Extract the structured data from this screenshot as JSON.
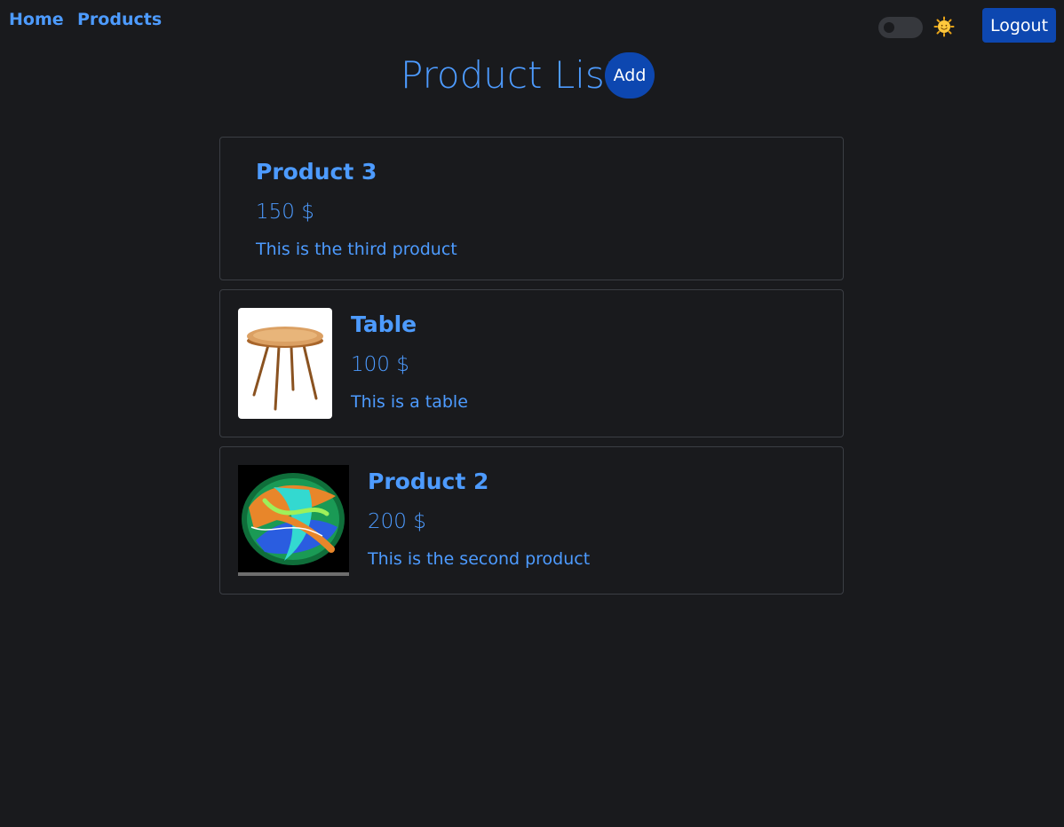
{
  "nav": {
    "home_label": "Home",
    "products_label": "Products",
    "logout_label": "Logout",
    "theme_icon": "sun-icon"
  },
  "header": {
    "title": "Product List",
    "add_label": "Add"
  },
  "products": [
    {
      "name": "Product 3",
      "price": "150 $",
      "description": "This is the third product",
      "image": null
    },
    {
      "name": "Table",
      "price": "100 $",
      "description": "This is a table",
      "image": "table-image"
    },
    {
      "name": "Product 2",
      "price": "200 $",
      "description": "This is the second product",
      "image": "abstract-art-image"
    }
  ],
  "colors": {
    "background": "#191a1d",
    "accent": "#4d9bff",
    "button": "#0d47b0",
    "card_border": "#3b3e44"
  }
}
